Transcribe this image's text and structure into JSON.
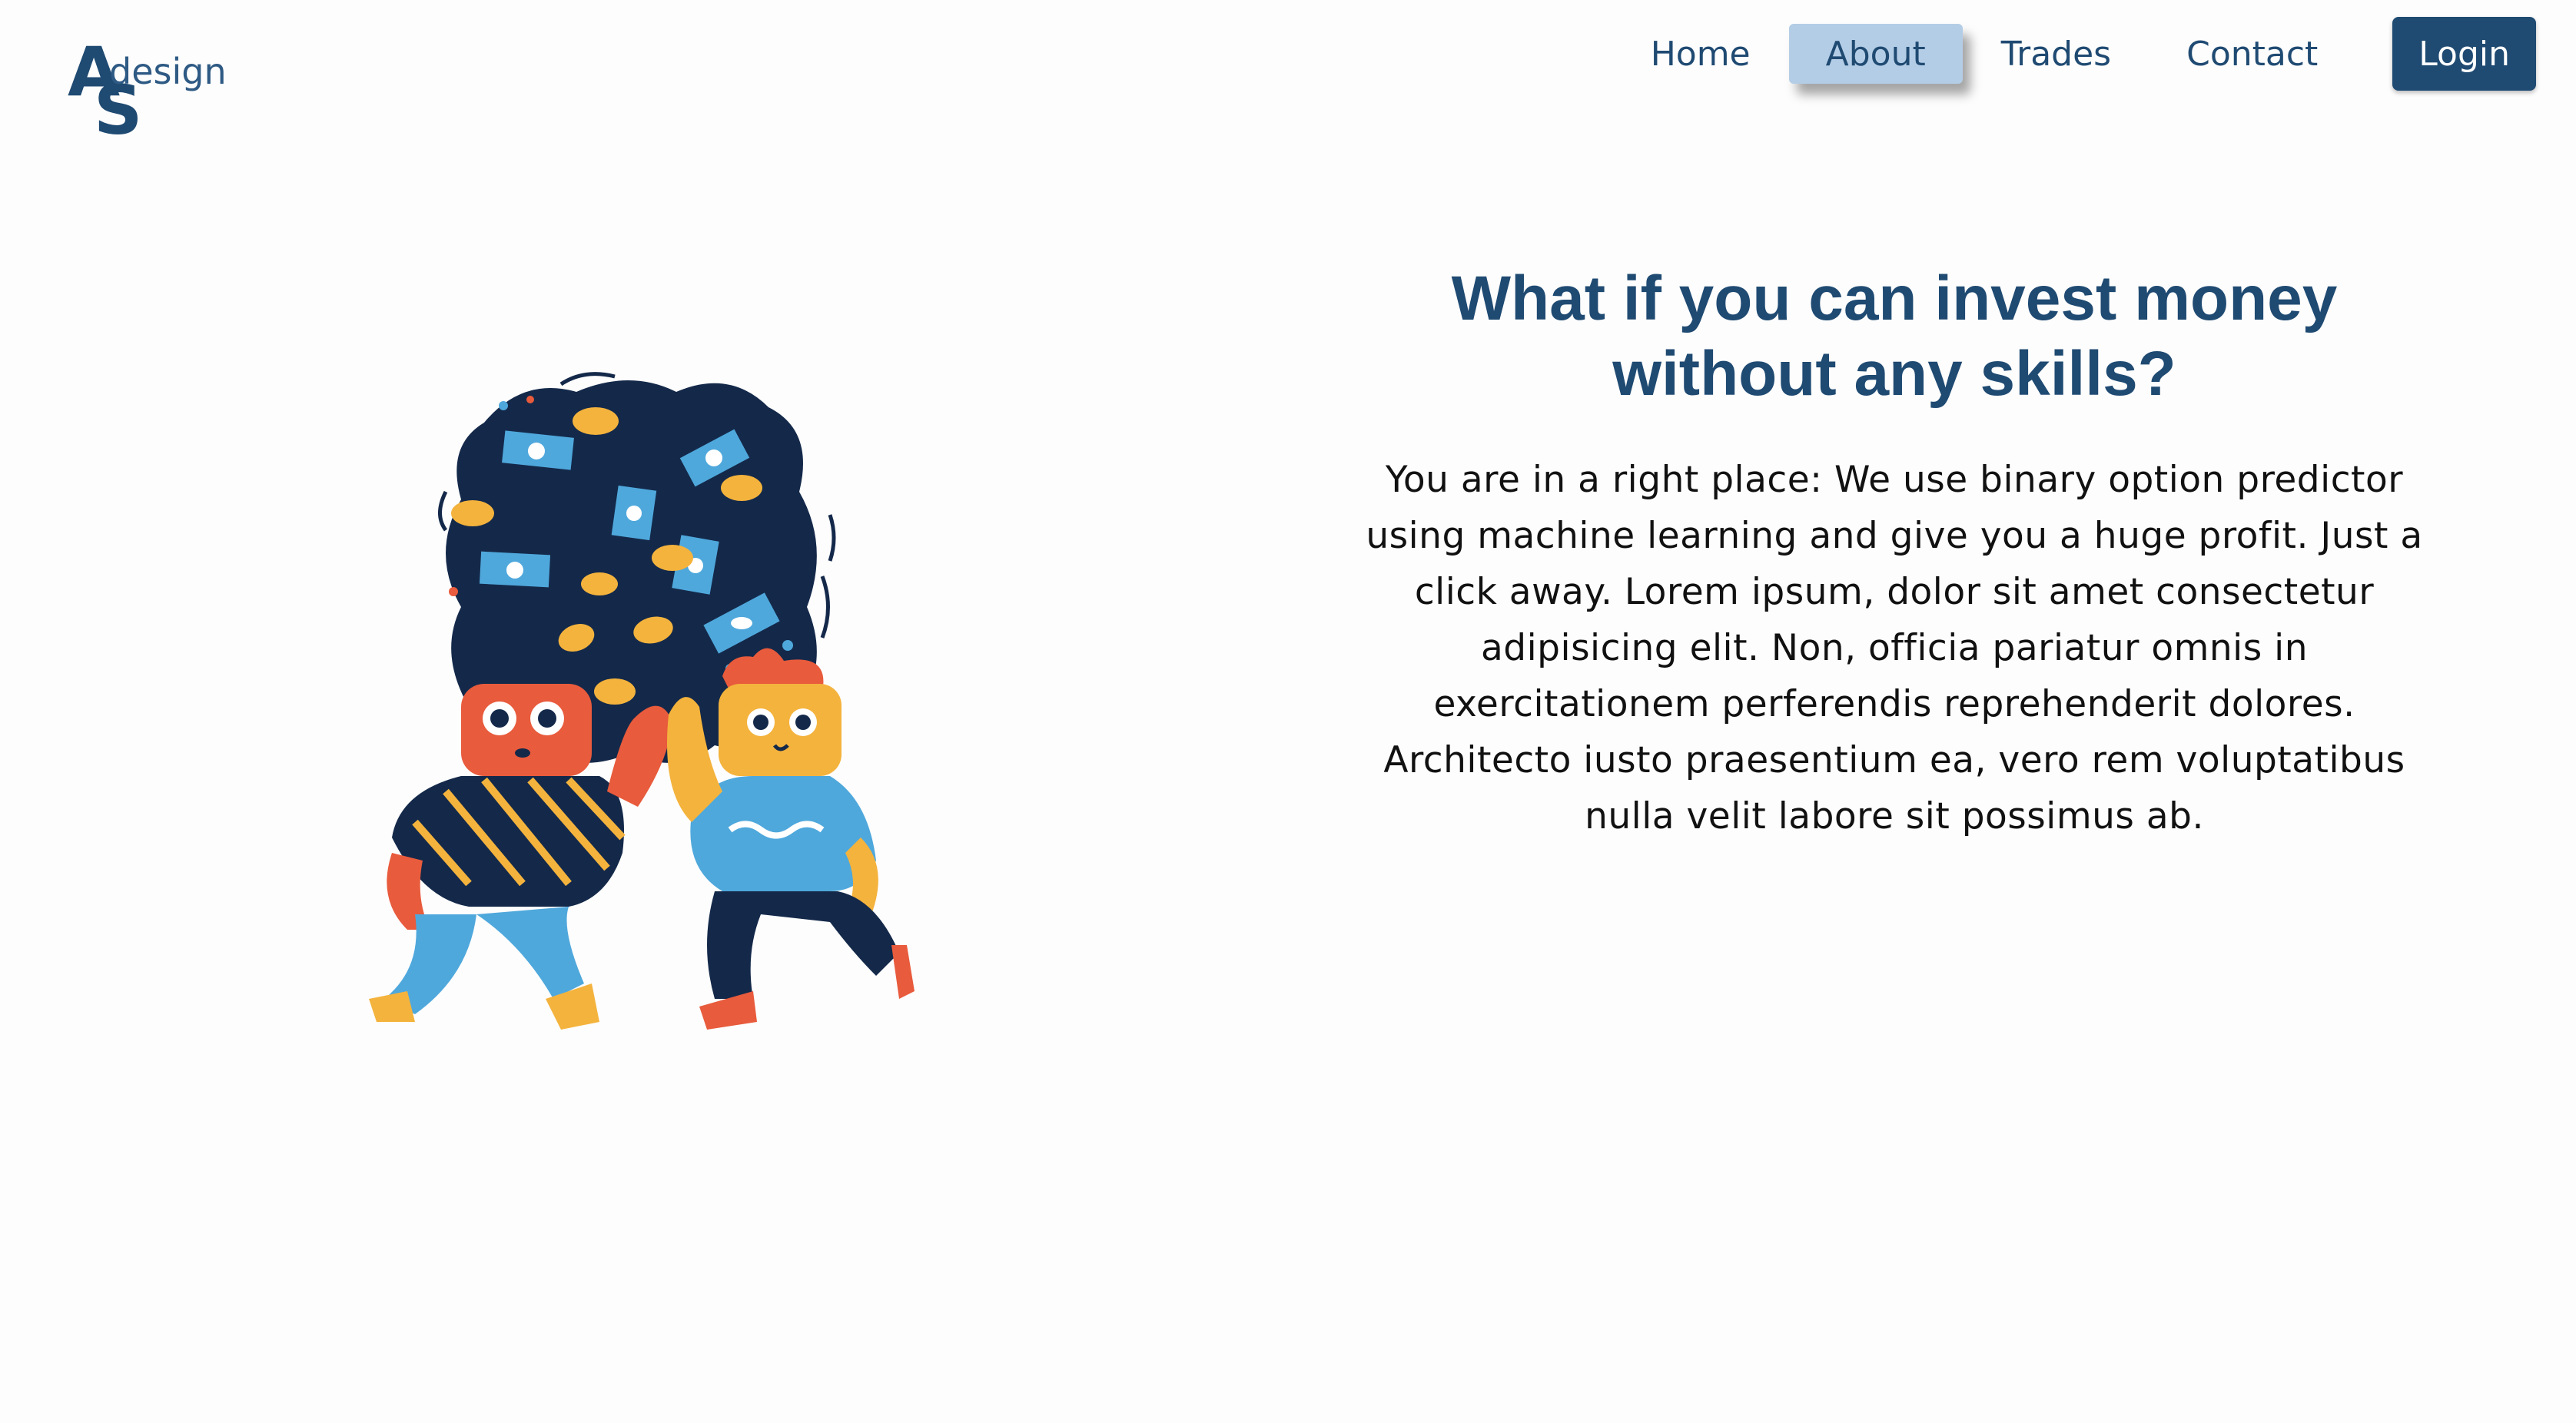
{
  "logo": {
    "letter_a": "A",
    "letter_s": "S",
    "word": "design"
  },
  "nav": {
    "items": [
      {
        "label": "Home",
        "active": false
      },
      {
        "label": "About",
        "active": true
      },
      {
        "label": "Trades",
        "active": false
      },
      {
        "label": "Contact",
        "active": false
      }
    ],
    "login_label": "Login"
  },
  "hero": {
    "title_line1": "What if you can invest money",
    "title_line2": "without any skills?",
    "body": "You are in a right place: We use binary option predictor using machine learning and give you a huge profit. Just a click away. Lorem ipsum, dolor sit amet consectetur adipisicing elit. Non, officia pariatur omnis in exercitationem perferendis reprehenderit dolores. Architecto iusto praesentium ea, vero rem voluptatibus nulla velit labore sit possimus ab."
  },
  "colors": {
    "brand": "#1f4a72",
    "nav_active_bg": "#b4cde6",
    "background": "#fdfdfd"
  },
  "illustration": {
    "subject": "two-characters-high-five-money-cloud"
  }
}
